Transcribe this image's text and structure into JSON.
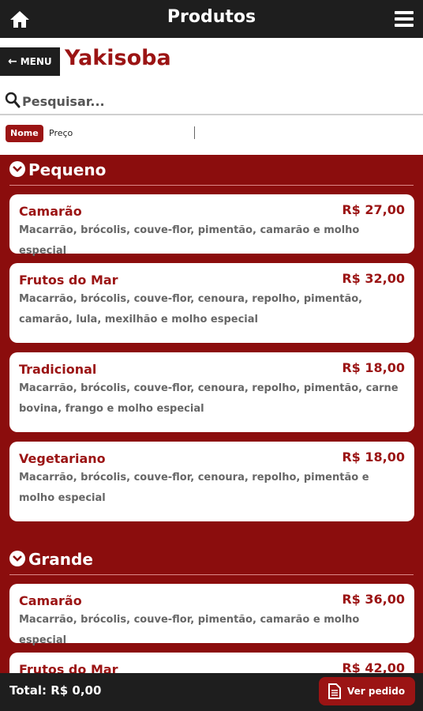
{
  "header": {
    "title": "Produtos"
  },
  "nav": {
    "menu_label": "MENU"
  },
  "category": {
    "title": "Yakisoba"
  },
  "search": {
    "placeholder": "Pesquisar..."
  },
  "sort": {
    "name_label": "Nome",
    "price_label": "Preço"
  },
  "sections": [
    {
      "title": "Pequeno",
      "items": [
        {
          "name": "Camarão",
          "price": "R$ 27,00",
          "desc": "Macarrão, brócolis, couve-flor, pimentão, camarão e molho especial"
        },
        {
          "name": "Frutos do Mar",
          "price": "R$ 32,00",
          "desc": "Macarrão, brócolis, couve-flor, cenoura, repolho, pimentão, camarão, lula, mexilhão e molho especial"
        },
        {
          "name": "Tradicional",
          "price": "R$ 18,00",
          "desc": "Macarrão, brócolis, couve-flor, cenoura, repolho, pimentão, carne bovina, frango e molho especial"
        },
        {
          "name": "Vegetariano",
          "price": "R$ 18,00",
          "desc": "Macarrão, brócolis, couve-flor, cenoura, repolho, pimentão e molho especial"
        }
      ]
    },
    {
      "title": "Grande",
      "items": [
        {
          "name": "Camarão",
          "price": "R$ 36,00",
          "desc": "Macarrão, brócolis, couve-flor, pimentão, camarão e molho especial"
        },
        {
          "name": "Frutos do Mar",
          "price": "R$ 42,00",
          "desc": ""
        }
      ]
    }
  ],
  "footer": {
    "total": "Total: R$ 0,00",
    "order_label": "Ver pedido"
  }
}
